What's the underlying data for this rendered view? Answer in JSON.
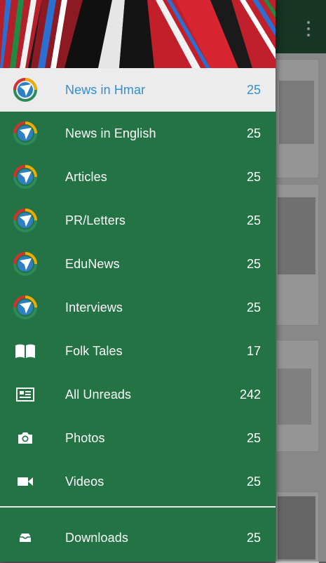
{
  "app_bar": {
    "overflow_icon": "more-vert-icon"
  },
  "colors": {
    "drawer_bg": "#237345",
    "active_row_bg": "#ececec",
    "active_text": "#2f8fd6",
    "text": "#ffffff",
    "toolbar": "#1f4a33"
  },
  "drawer": {
    "items": [
      {
        "label": "News in Hmar",
        "count": "25",
        "icon": "feed-logo-icon",
        "active": true
      },
      {
        "label": "News in English",
        "count": "25",
        "icon": "feed-logo-icon"
      },
      {
        "label": "Articles",
        "count": "25",
        "icon": "feed-logo-icon"
      },
      {
        "label": "PR/Letters",
        "count": "25",
        "icon": "feed-logo-icon"
      },
      {
        "label": "EduNews",
        "count": "25",
        "icon": "feed-logo-icon"
      },
      {
        "label": "Interviews",
        "count": "25",
        "icon": "feed-logo-icon"
      },
      {
        "label": "Folk Tales",
        "count": "17",
        "icon": "book-icon"
      },
      {
        "label": "All Unreads",
        "count": "242",
        "icon": "newspaper-icon"
      },
      {
        "label": "Photos",
        "count": "25",
        "icon": "camera-icon"
      },
      {
        "label": "Videos",
        "count": "25",
        "icon": "videocam-icon"
      }
    ],
    "footer_item": {
      "label": "Downloads",
      "count": "25",
      "icon": "download-tray-icon"
    }
  }
}
